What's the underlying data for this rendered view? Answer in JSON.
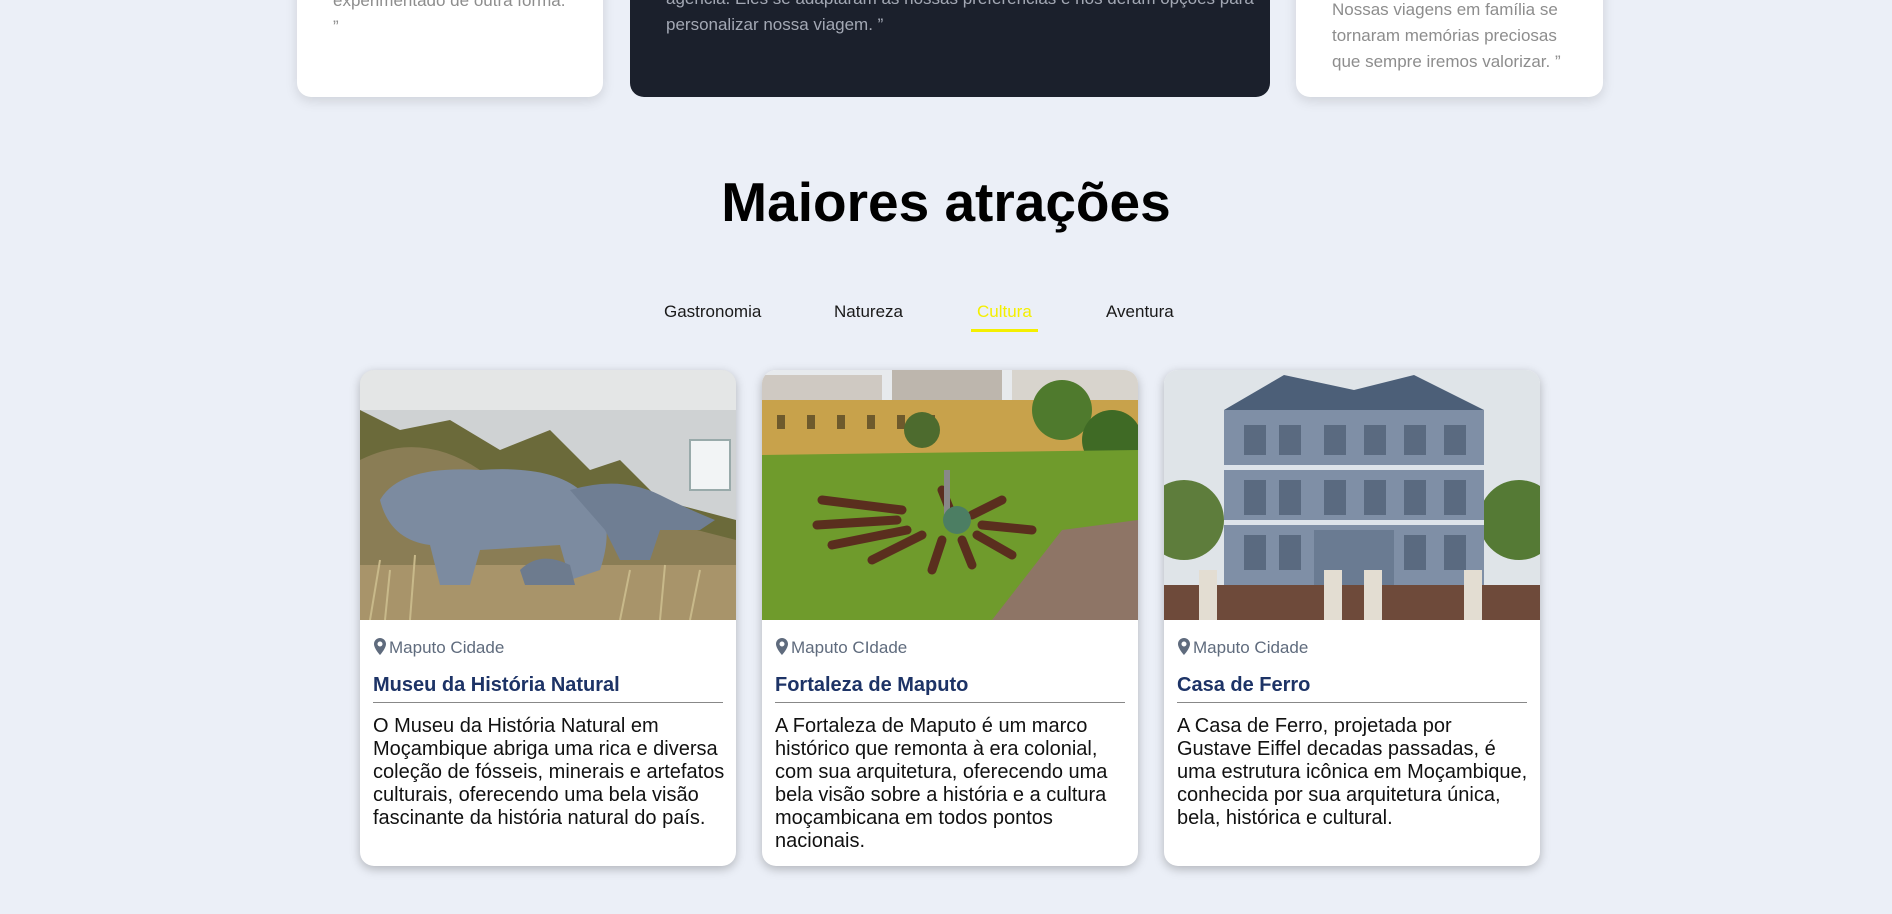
{
  "testimonials": [
    {
      "text": "experimentado de outra forma.\n”"
    },
    {
      "text": "perguntas com paciência. Eu aprecio especialmente a flexibilidade da agência. Eles se adaptaram às nossas preferências e nos deram opções para personalizar nossa viagem. ”"
    },
    {
      "text": "Nossas viagens em família se tornaram memórias preciosas que sempre iremos valorizar. ”"
    }
  ],
  "attractions": {
    "title": "Maiores atrações",
    "tabs": [
      {
        "label": "Gastronomia"
      },
      {
        "label": "Natureza"
      },
      {
        "label": "Cultura",
        "active": true
      },
      {
        "label": "Aventura"
      }
    ],
    "cards": [
      {
        "location": "Maputo Cidade",
        "title": "Museu da História Natural",
        "description": "O Museu da História Natural em Moçambique abriga uma rica e diversa coleção de fósseis, minerais e artefatos culturais, oferecendo uma bela visão fascinante da história natural do país.",
        "image_icon": "museum-photo"
      },
      {
        "location": "Maputo CIdade",
        "title": "Fortaleza de Maputo",
        "description": "A Fortaleza de Maputo é um marco histórico que remonta à era colonial, com sua arquitetura, oferecendo uma bela visão sobre a história e a cultura moçambicana em todos pontos nacionais.",
        "image_icon": "fortress-photo"
      },
      {
        "location": "Maputo Cidade",
        "title": "Casa de Ferro",
        "description": "A Casa de Ferro, projetada por Gustave Eiffel decadas passadas, é uma estrutura icônica em Moçambique, conhecida por sua arquitetura única, bela, histórica e cultural.",
        "image_icon": "iron-house-photo"
      }
    ]
  },
  "colors": {
    "background": "#ebeff7",
    "active_tab": "#f4ef00",
    "card_title": "#1d3366",
    "dark_card": "#1b202c"
  }
}
